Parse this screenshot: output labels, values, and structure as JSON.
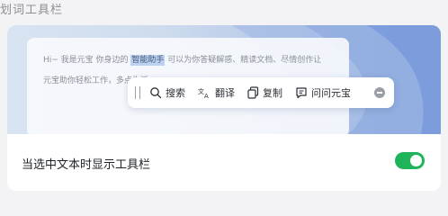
{
  "section": {
    "title": "划词工具栏"
  },
  "preview": {
    "line1_before": "Hi~ 我是元宝 你身边的",
    "line1_highlight": "智能助手",
    "line1_after": " 可以为你答疑解惑、精读文档、尽情创作让",
    "line2": "元宝助你轻松工作，多点生活"
  },
  "toolbar": {
    "buttons": [
      {
        "label": "搜索",
        "icon": "search-icon"
      },
      {
        "label": "翻译",
        "icon": "translate-icon"
      },
      {
        "label": "复制",
        "icon": "copy-icon"
      },
      {
        "label": "问问元宝",
        "icon": "chat-icon"
      }
    ],
    "close_icon": "minus-circle-icon"
  },
  "setting": {
    "label": "当选中文本时显示工具栏",
    "toggle_on": true,
    "toggle_color": "#1fb35a"
  }
}
